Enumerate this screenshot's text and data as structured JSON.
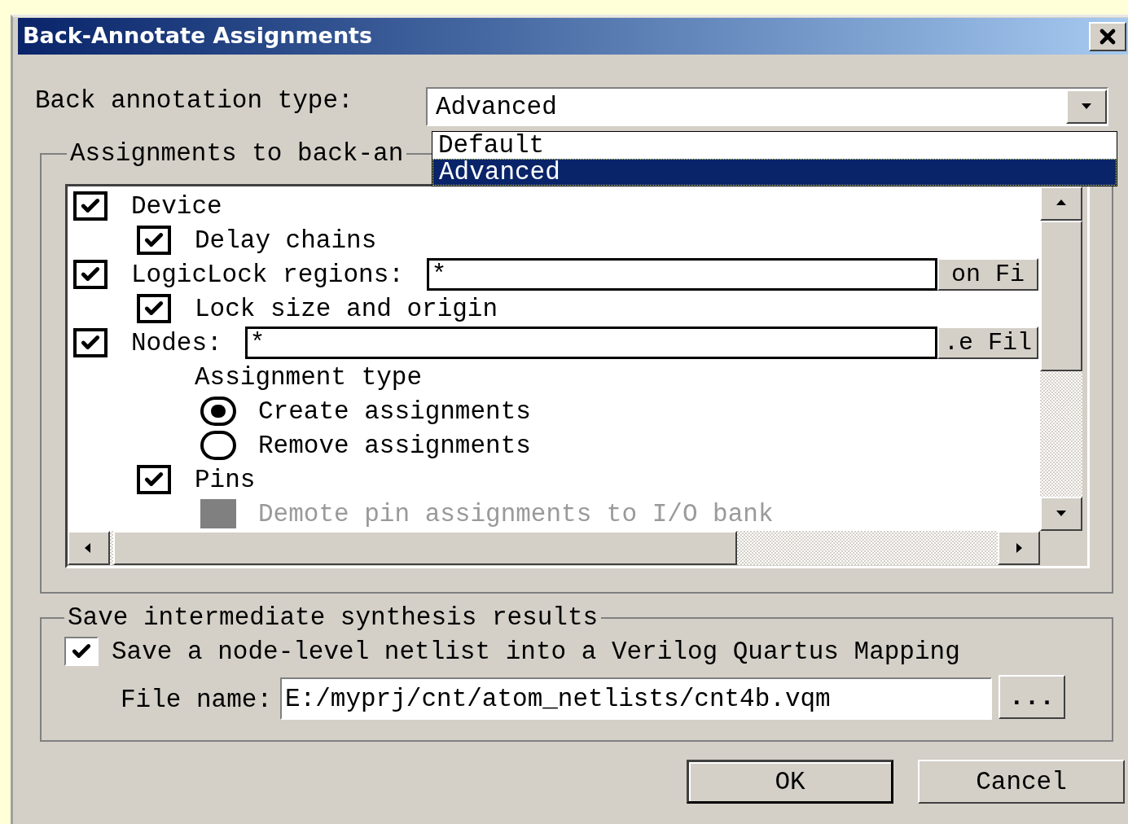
{
  "window": {
    "title": "Back-Annotate Assignments"
  },
  "back_annotation_type": {
    "label": "Back annotation type:",
    "value": "Advanced",
    "expanded": true,
    "options": [
      {
        "label": "Default",
        "selected": false
      },
      {
        "label": "Advanced",
        "selected": true
      }
    ]
  },
  "assignments": {
    "title": "Assignments to back-an",
    "items": [
      {
        "kind": "checkbox",
        "label": "Device",
        "checked": true,
        "children": [
          {
            "kind": "checkbox",
            "label": "Delay chains",
            "checked": true
          }
        ]
      },
      {
        "kind": "field",
        "label": "LogicLock regions:",
        "checked": true,
        "value": "*",
        "button": "on Fi",
        "children": [
          {
            "kind": "checkbox",
            "label": "Lock size and origin",
            "checked": true
          }
        ]
      },
      {
        "kind": "field",
        "label": "Nodes:",
        "checked": true,
        "value": "*",
        "button": ".e Fil",
        "children": [
          {
            "kind": "heading",
            "label": "Assignment type",
            "children": [
              {
                "kind": "radio",
                "label": "Create assignments",
                "selected": true
              },
              {
                "kind": "radio",
                "label": "Remove assignments",
                "selected": false
              }
            ]
          },
          {
            "kind": "checkbox",
            "label": "Pins",
            "checked": true,
            "children": [
              {
                "kind": "checkbox",
                "label": "Demote pin assignments to I/O bank",
                "checked": false,
                "disabled": true
              }
            ]
          }
        ]
      }
    ]
  },
  "save_group": {
    "title": "Save intermediate synthesis results",
    "save_netlist": {
      "label": "Save a node-level netlist into a Verilog Quartus Mapping",
      "checked": true
    },
    "file_name": {
      "label": "File name:",
      "value": "E:/myprj/cnt/atom_netlists/cnt4b.vqm"
    },
    "browse": "..."
  },
  "buttons": [
    {
      "label": "OK",
      "default": true
    },
    {
      "label": "Cancel",
      "default": false
    }
  ]
}
